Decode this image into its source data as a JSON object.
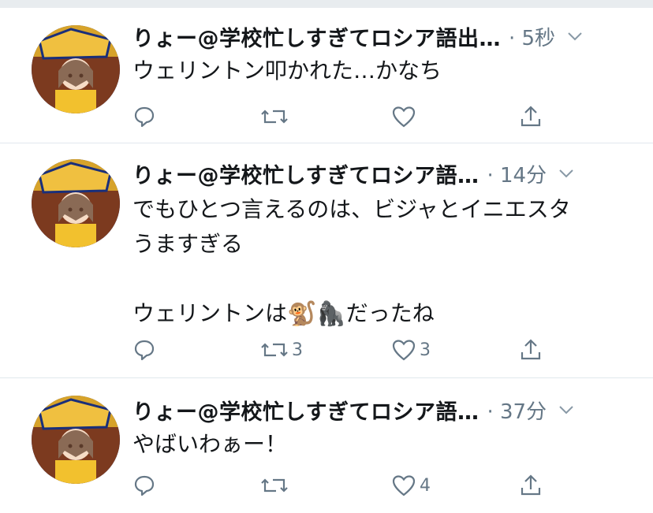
{
  "tweets": [
    {
      "name": "りょー@学校忙しすぎてロシア語出…",
      "time": "· 5秒",
      "text": "ウェリントン叩かれた…かなち",
      "reply_count": "",
      "retweet_count": "",
      "like_count": ""
    },
    {
      "name": "りょー@学校忙しすぎてロシア語…",
      "time": "· 14分",
      "text_line1": "でもひとつ言えるのは、ビジャとイニエスタ",
      "text_line2": "うますぎる",
      "text_line3_prefix": "ウェリントンは",
      "emoji_monkey": "🐒",
      "emoji_gorilla": "🦍",
      "text_line3_suffix": "だったね",
      "reply_count": "",
      "retweet_count": "3",
      "like_count": "3"
    },
    {
      "name": "りょー@学校忙しすぎてロシア語…",
      "time": "· 37分",
      "text": "やばいわぁー！",
      "reply_count": "",
      "retweet_count": "",
      "like_count": "4"
    }
  ],
  "icons": {
    "reply": "reply-icon",
    "retweet": "retweet-icon",
    "like": "heart-icon",
    "share": "share-icon",
    "caret": "chevron-down-icon"
  },
  "colors": {
    "text": "#14171a",
    "secondary": "#657786",
    "divider": "#e1e8ed"
  }
}
